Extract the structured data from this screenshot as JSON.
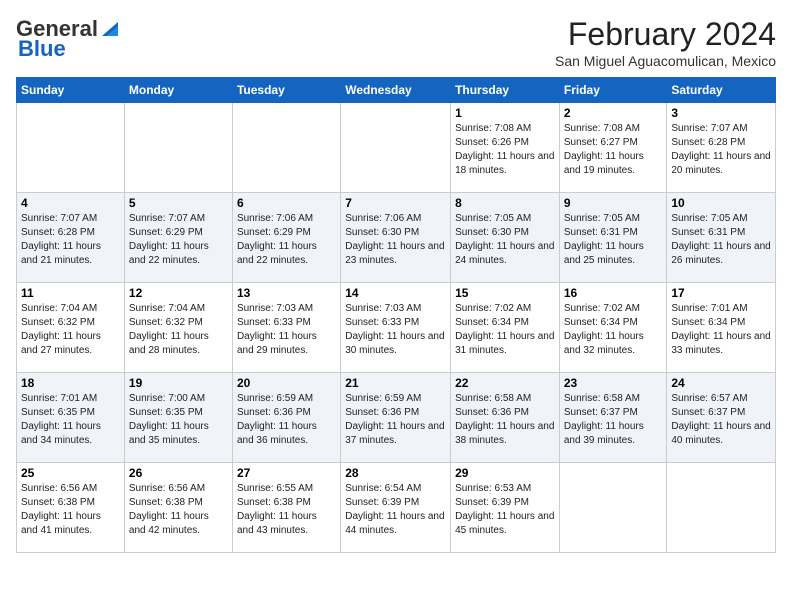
{
  "logo": {
    "general": "General",
    "blue": "Blue"
  },
  "header": {
    "title": "February 2024",
    "location": "San Miguel Aguacomulican, Mexico"
  },
  "weekdays": [
    "Sunday",
    "Monday",
    "Tuesday",
    "Wednesday",
    "Thursday",
    "Friday",
    "Saturday"
  ],
  "weeks": [
    [
      {
        "day": "",
        "info": ""
      },
      {
        "day": "",
        "info": ""
      },
      {
        "day": "",
        "info": ""
      },
      {
        "day": "",
        "info": ""
      },
      {
        "day": "1",
        "info": "Sunrise: 7:08 AM\nSunset: 6:26 PM\nDaylight: 11 hours and 18 minutes."
      },
      {
        "day": "2",
        "info": "Sunrise: 7:08 AM\nSunset: 6:27 PM\nDaylight: 11 hours and 19 minutes."
      },
      {
        "day": "3",
        "info": "Sunrise: 7:07 AM\nSunset: 6:28 PM\nDaylight: 11 hours and 20 minutes."
      }
    ],
    [
      {
        "day": "4",
        "info": "Sunrise: 7:07 AM\nSunset: 6:28 PM\nDaylight: 11 hours and 21 minutes."
      },
      {
        "day": "5",
        "info": "Sunrise: 7:07 AM\nSunset: 6:29 PM\nDaylight: 11 hours and 22 minutes."
      },
      {
        "day": "6",
        "info": "Sunrise: 7:06 AM\nSunset: 6:29 PM\nDaylight: 11 hours and 22 minutes."
      },
      {
        "day": "7",
        "info": "Sunrise: 7:06 AM\nSunset: 6:30 PM\nDaylight: 11 hours and 23 minutes."
      },
      {
        "day": "8",
        "info": "Sunrise: 7:05 AM\nSunset: 6:30 PM\nDaylight: 11 hours and 24 minutes."
      },
      {
        "day": "9",
        "info": "Sunrise: 7:05 AM\nSunset: 6:31 PM\nDaylight: 11 hours and 25 minutes."
      },
      {
        "day": "10",
        "info": "Sunrise: 7:05 AM\nSunset: 6:31 PM\nDaylight: 11 hours and 26 minutes."
      }
    ],
    [
      {
        "day": "11",
        "info": "Sunrise: 7:04 AM\nSunset: 6:32 PM\nDaylight: 11 hours and 27 minutes."
      },
      {
        "day": "12",
        "info": "Sunrise: 7:04 AM\nSunset: 6:32 PM\nDaylight: 11 hours and 28 minutes."
      },
      {
        "day": "13",
        "info": "Sunrise: 7:03 AM\nSunset: 6:33 PM\nDaylight: 11 hours and 29 minutes."
      },
      {
        "day": "14",
        "info": "Sunrise: 7:03 AM\nSunset: 6:33 PM\nDaylight: 11 hours and 30 minutes."
      },
      {
        "day": "15",
        "info": "Sunrise: 7:02 AM\nSunset: 6:34 PM\nDaylight: 11 hours and 31 minutes."
      },
      {
        "day": "16",
        "info": "Sunrise: 7:02 AM\nSunset: 6:34 PM\nDaylight: 11 hours and 32 minutes."
      },
      {
        "day": "17",
        "info": "Sunrise: 7:01 AM\nSunset: 6:34 PM\nDaylight: 11 hours and 33 minutes."
      }
    ],
    [
      {
        "day": "18",
        "info": "Sunrise: 7:01 AM\nSunset: 6:35 PM\nDaylight: 11 hours and 34 minutes."
      },
      {
        "day": "19",
        "info": "Sunrise: 7:00 AM\nSunset: 6:35 PM\nDaylight: 11 hours and 35 minutes."
      },
      {
        "day": "20",
        "info": "Sunrise: 6:59 AM\nSunset: 6:36 PM\nDaylight: 11 hours and 36 minutes."
      },
      {
        "day": "21",
        "info": "Sunrise: 6:59 AM\nSunset: 6:36 PM\nDaylight: 11 hours and 37 minutes."
      },
      {
        "day": "22",
        "info": "Sunrise: 6:58 AM\nSunset: 6:36 PM\nDaylight: 11 hours and 38 minutes."
      },
      {
        "day": "23",
        "info": "Sunrise: 6:58 AM\nSunset: 6:37 PM\nDaylight: 11 hours and 39 minutes."
      },
      {
        "day": "24",
        "info": "Sunrise: 6:57 AM\nSunset: 6:37 PM\nDaylight: 11 hours and 40 minutes."
      }
    ],
    [
      {
        "day": "25",
        "info": "Sunrise: 6:56 AM\nSunset: 6:38 PM\nDaylight: 11 hours and 41 minutes."
      },
      {
        "day": "26",
        "info": "Sunrise: 6:56 AM\nSunset: 6:38 PM\nDaylight: 11 hours and 42 minutes."
      },
      {
        "day": "27",
        "info": "Sunrise: 6:55 AM\nSunset: 6:38 PM\nDaylight: 11 hours and 43 minutes."
      },
      {
        "day": "28",
        "info": "Sunrise: 6:54 AM\nSunset: 6:39 PM\nDaylight: 11 hours and 44 minutes."
      },
      {
        "day": "29",
        "info": "Sunrise: 6:53 AM\nSunset: 6:39 PM\nDaylight: 11 hours and 45 minutes."
      },
      {
        "day": "",
        "info": ""
      },
      {
        "day": "",
        "info": ""
      }
    ]
  ]
}
